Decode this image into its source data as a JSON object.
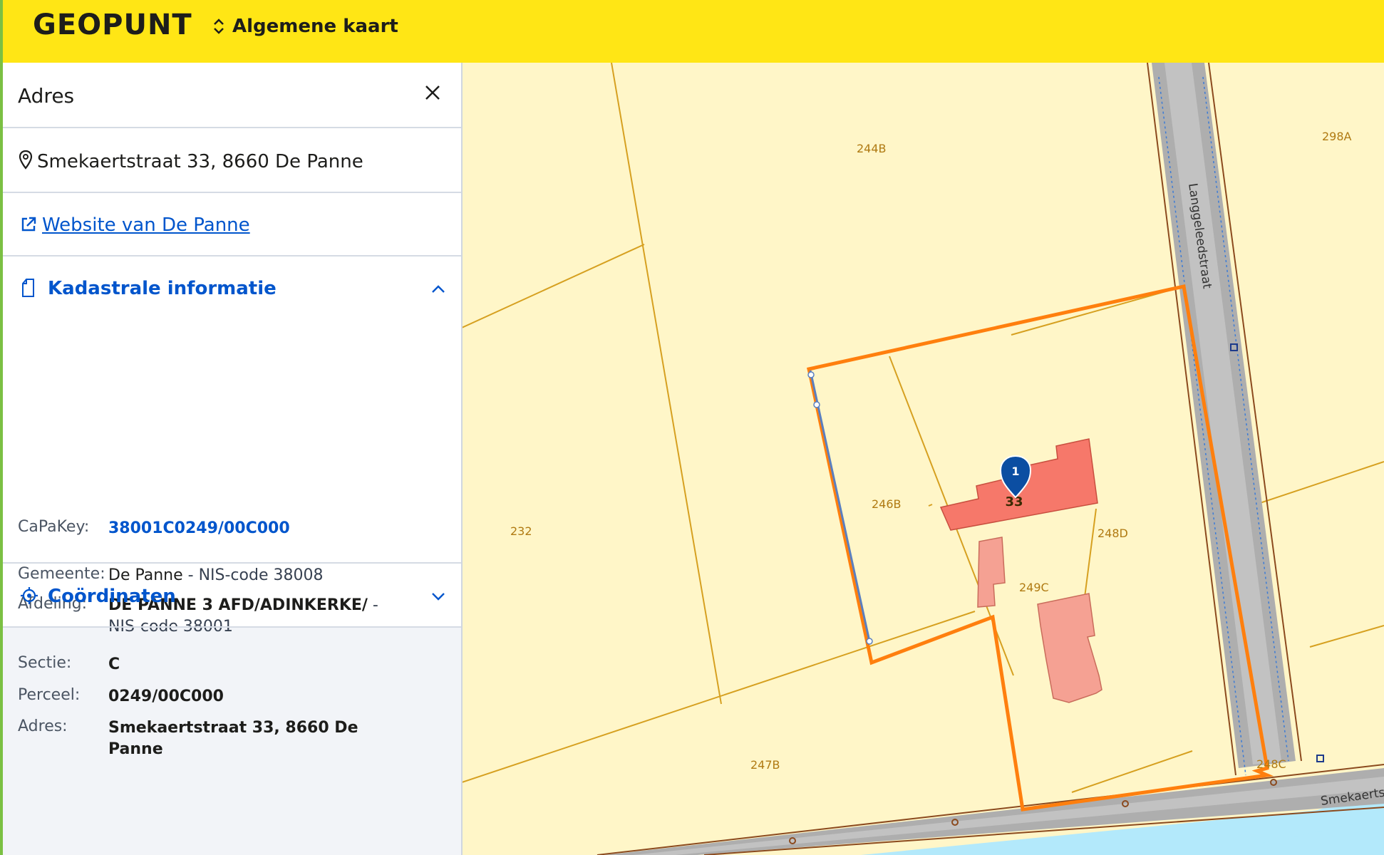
{
  "header": {
    "logo": "GEOPUNT",
    "map_selector": "Algemene kaart"
  },
  "panel": {
    "title": "Adres",
    "address": "Smekaertstraat 33, 8660 De Panne",
    "website_link": "Website van De Panne",
    "kadastraal": {
      "title": "Kadastrale informatie",
      "capakey_label": "CaPaKey:",
      "capakey_value": "38001C0249/00C000",
      "gemeente_label": "Gemeente:",
      "gemeente_name": "De Panne",
      "gemeente_code": " - NIS-code 38008",
      "afdeling_label": "Afdeling:",
      "afdeling_name": "DE PANNE 3 AFD/ADINKERKE/",
      "afdeling_code": " - NIS-code 38001",
      "sectie_label": "Sectie:",
      "sectie_value": "C",
      "perceel_label": "Perceel:",
      "perceel_value": "0249/00C000",
      "adres_label": "Adres:",
      "adres_value": "Smekaertstraat 33, 8660 De Panne"
    },
    "coordinaten_title": "Coördinaten"
  },
  "map": {
    "parcels": [
      "244B",
      "298A",
      "232",
      "246B",
      "248D",
      "249C",
      "247B",
      "248C"
    ],
    "streets": [
      "Langgeleedstraat",
      "Smekaertst"
    ],
    "house_number": "33",
    "marker_number": "1"
  },
  "colors": {
    "header_bg": "#ffe615",
    "accent_blue": "#0055cc",
    "map_bg": "#fff6c8",
    "selection": "#ff7f0e",
    "building": "#f6786a"
  }
}
